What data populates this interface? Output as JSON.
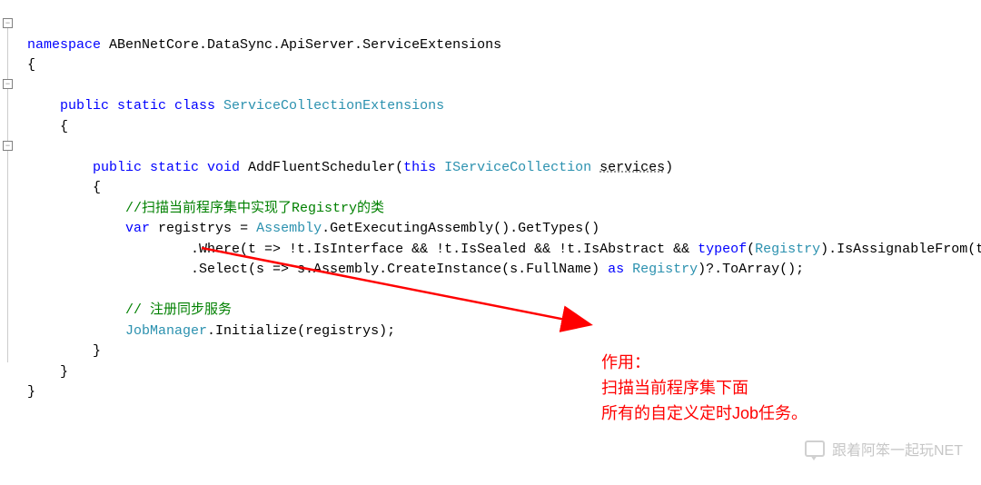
{
  "code": {
    "ns_keyword": "namespace",
    "ns_name": " ABenNetCore.DataSync.ApiServer.ServiceExtensions",
    "brace_open": "{",
    "brace_close": "}",
    "class_mods": "public static class ",
    "class_name": "ServiceCollectionExtensions",
    "method_mods": "public static void ",
    "method_name": "AddFluentScheduler(",
    "this_kw": "this",
    "iservice": " IServiceCollection ",
    "services_param": "services",
    "close_paren": ")",
    "comment1": "//扫描当前程序集中实现了Registry的类",
    "var_kw": "var",
    "registrys_eq": " registrys = ",
    "assembly_type": "Assembly",
    "get_exec": ".GetExecutingAssembly().GetTypes()",
    "where_line_pre": ".Where(t => !t.IsInterface && !t.IsSealed && !t.IsAbstract && ",
    "typeof_kw": "typeof",
    "lparen": "(",
    "registry_type": "Registry",
    "where_line_post": ").IsAssignableFrom(t))",
    "select_pre": ".Select(s => s.Assembly.CreateInstance(s.FullName) ",
    "as_kw": "as",
    "space": " ",
    "select_post": ")?.ToArray();",
    "comment2": "// 注册同步服务",
    "jobmanager": "JobManager",
    "initialize": ".Initialize(registrys);"
  },
  "annotation": {
    "line1": "作用：",
    "line2": "扫描当前程序集下面",
    "line3": "所有的自定义定时Job任务。"
  },
  "watermark": {
    "text": "跟着阿笨一起玩NET"
  }
}
